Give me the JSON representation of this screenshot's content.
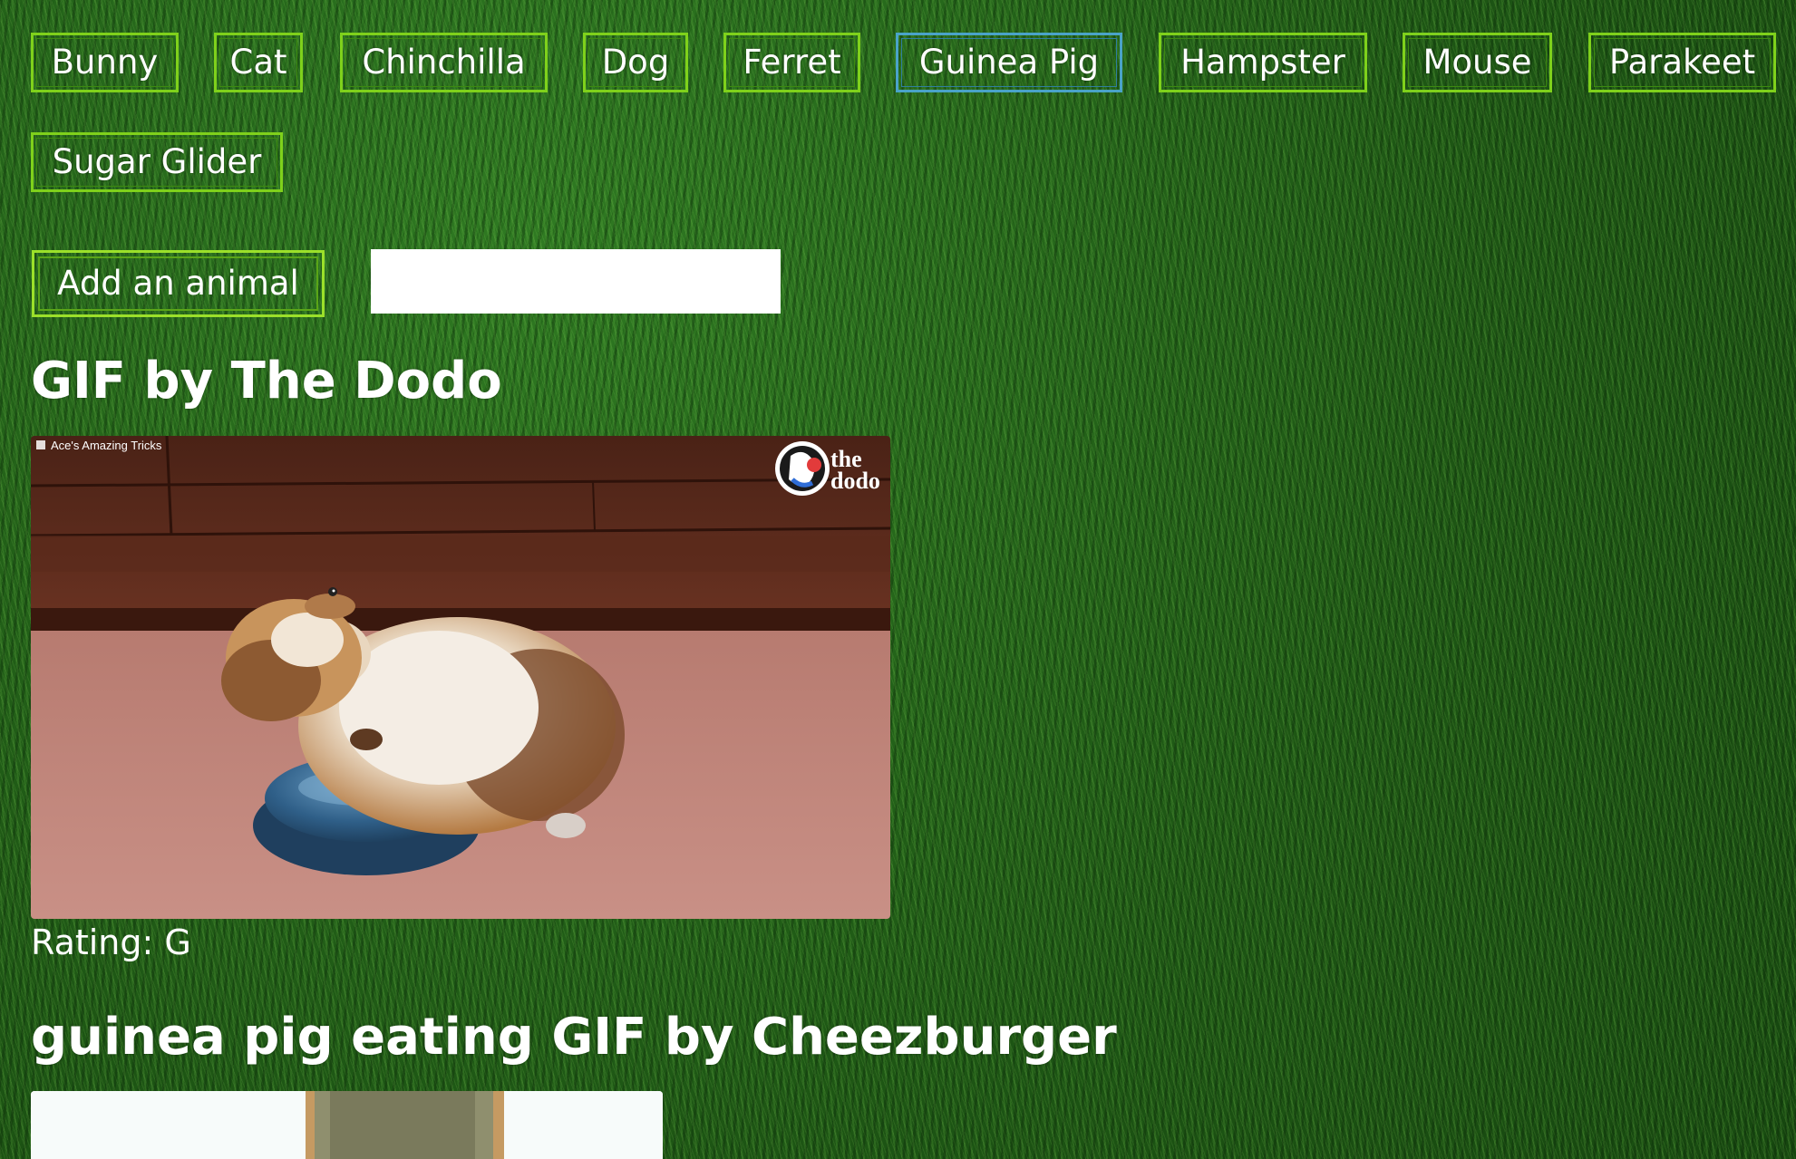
{
  "animals": [
    "Bunny",
    "Cat",
    "Chinchilla",
    "Dog",
    "Ferret",
    "Guinea Pig",
    "Hampster",
    "Mouse",
    "Parakeet",
    "Sugar Glider"
  ],
  "focused_animal": "Guinea Pig",
  "add_button_label": "Add an animal",
  "add_input_value": "",
  "gifs": [
    {
      "title": "GIF by The Dodo",
      "rating": "Rating: G",
      "caption": "Ace's Amazing Tricks",
      "logo_text_1": "the",
      "logo_text_2": "dodo"
    },
    {
      "title": "guinea pig eating GIF by Cheezburger"
    }
  ],
  "colors": {
    "button_border": "#7fd11b",
    "focused_border": "#4aa3c8",
    "background": "#1f5a16",
    "text": "#ffffff"
  }
}
